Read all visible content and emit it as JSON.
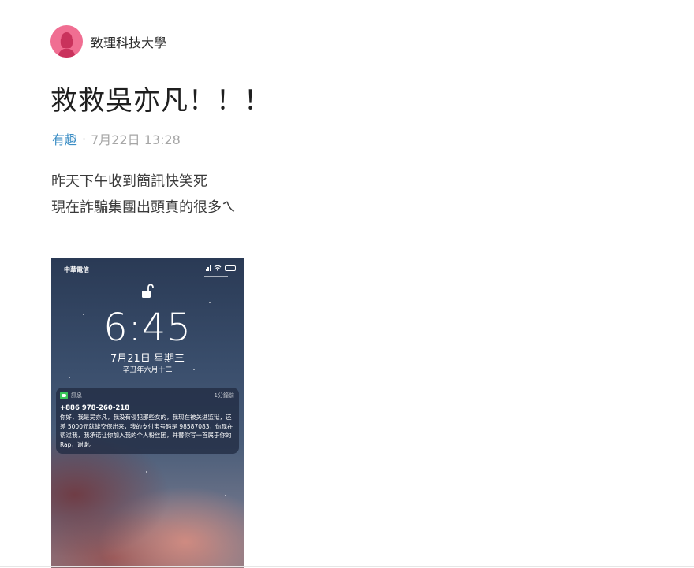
{
  "author": {
    "name": "致理科技大學"
  },
  "post": {
    "title": "救救吳亦凡！！！",
    "category": "有趣",
    "separator": "·",
    "timestamp": "7月22日 13:28",
    "body_lines": [
      "昨天下午收到簡訊快笑死",
      "現在詐騙集團出頭真的很多ㄟ"
    ]
  },
  "phone": {
    "carrier": "中華電信",
    "time": "6:45",
    "date": "7月21日 星期三",
    "lunar_date": "辛丑年六月十二",
    "notification": {
      "app": "訊息",
      "age": "1分鐘前",
      "sender": "+886 978-260-218",
      "body": "你好，我是吴亦凡，我没有侵犯那些女的，我现在被关进监狱，还差 5000元就能交保出来，我的支付宝号码是 98587083，你现在帮过我，我承诺让你加入我的个人粉丝团，并替你写一首属于你的 Rap，谢谢。"
    }
  },
  "colors": {
    "avatar": "#f06e92",
    "category_link": "#3c8ec5",
    "message_app": "#39c65a",
    "battery": "#f4d23a"
  }
}
